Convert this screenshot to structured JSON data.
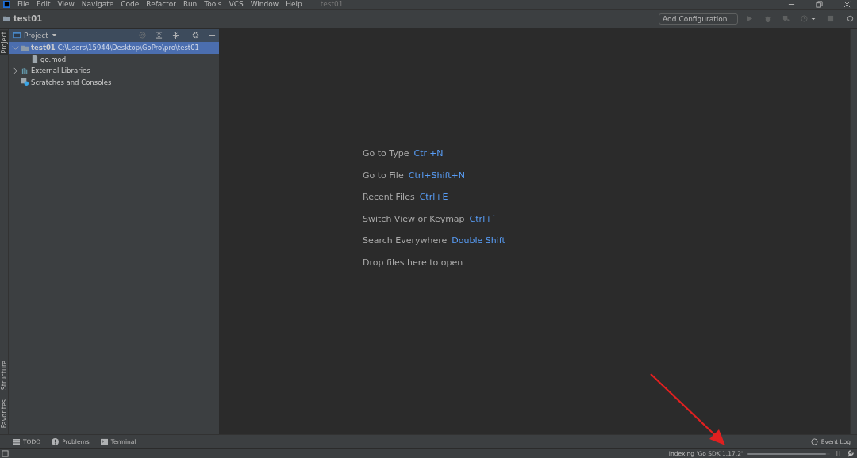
{
  "menu": [
    "File",
    "Edit",
    "View",
    "Navigate",
    "Code",
    "Refactor",
    "Run",
    "Tools",
    "VCS",
    "Window",
    "Help"
  ],
  "window": {
    "title": "test01"
  },
  "breadcrumb": "test01",
  "toolbar": {
    "config_button": "Add Configuration..."
  },
  "left_stripe": {
    "top": [
      {
        "label": "Project",
        "selected": true
      }
    ],
    "bottom": [
      {
        "label": "Structure",
        "selected": false
      },
      {
        "label": "Favorites",
        "selected": false
      }
    ]
  },
  "project_panel": {
    "title": "Project",
    "tree": [
      {
        "label": "test01",
        "path": "C:\\Users\\15944\\Desktop\\GoPro\\pro\\test01",
        "kind": "folder",
        "expanded": true,
        "selected": true,
        "children": [
          {
            "label": "go.mod",
            "kind": "file",
            "selected": false
          }
        ]
      },
      {
        "label": "External Libraries",
        "kind": "library",
        "expanded": false,
        "selected": false
      },
      {
        "label": "Scratches and Consoles",
        "kind": "scratch",
        "selected": false
      }
    ]
  },
  "editor_hints": [
    {
      "action": "Go to Type",
      "shortcut": "Ctrl+N"
    },
    {
      "action": "Go to File",
      "shortcut": "Ctrl+Shift+N"
    },
    {
      "action": "Recent Files",
      "shortcut": "Ctrl+E"
    },
    {
      "action": "Switch View or Keymap",
      "shortcut": "Ctrl+`"
    },
    {
      "action": "Search Everywhere",
      "shortcut": "Double Shift"
    },
    {
      "action": "Drop files here to open"
    }
  ],
  "bottom_tools": [
    {
      "label": "TODO",
      "kind": "todo"
    },
    {
      "label": "Problems",
      "kind": "problems"
    },
    {
      "label": "Terminal",
      "kind": "terminal"
    }
  ],
  "event_log": "Event Log",
  "status_bar": {
    "indexing": "Indexing 'Go SDK 1.17.2'",
    "progress": {
      "level": 0.95
    }
  }
}
